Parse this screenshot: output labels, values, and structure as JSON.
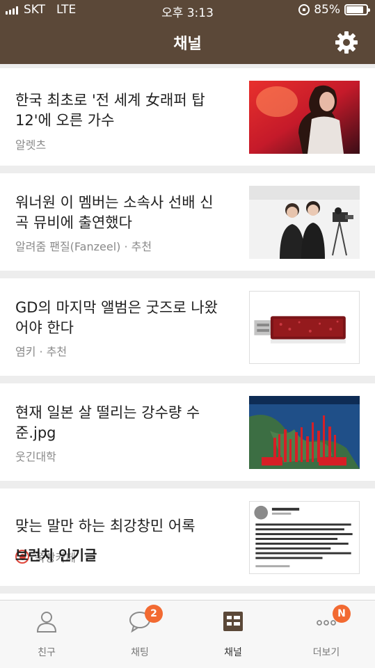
{
  "status_bar": {
    "carrier": "SKT",
    "network": "LTE",
    "time": "오후 3:13",
    "battery": "85%",
    "battery_level": 0.85
  },
  "header": {
    "title": "채널",
    "settings_icon": "gear-icon"
  },
  "articles": [
    {
      "headline": "한국 최초로 '전 세계 女래퍼 탑 12'에 오른 가수",
      "source": "알렛츠",
      "thumb": "singer-photo"
    },
    {
      "headline": "워너원 이 멤버는 소속사 선배 신곡 뮤비에 출연했다",
      "source": "알려줌 팬질(Fanzeel) · 추천",
      "thumb": "two-men-photo"
    },
    {
      "headline": "GD의 마지막 앨범은 굿즈로 나왔어야 한다",
      "source": "염키 · 추천",
      "thumb": "usb-drive-photo"
    },
    {
      "headline": "현재 일본 살 떨리는 강수량 수준.jpg",
      "source": "웃긴대학",
      "thumb": "rainfall-map"
    },
    {
      "headline": "맞는 말만 하는 최강창민 어록",
      "source": "쭉빵카페",
      "thumb": "tweet-screenshot"
    }
  ],
  "section_title": "브런치 인기글",
  "tabs": [
    {
      "label": "친구",
      "icon": "person-icon"
    },
    {
      "label": "채팅",
      "icon": "chat-bubble-icon",
      "badge": "2"
    },
    {
      "label": "채널",
      "icon": "channel-list-icon",
      "active": true
    },
    {
      "label": "더보기",
      "icon": "more-dots-icon",
      "badge": "N"
    }
  ],
  "colors": {
    "header": "#5b4838",
    "badge": "#f26a32",
    "text": "#1e1e1e",
    "subtext": "#8a8a8a"
  }
}
